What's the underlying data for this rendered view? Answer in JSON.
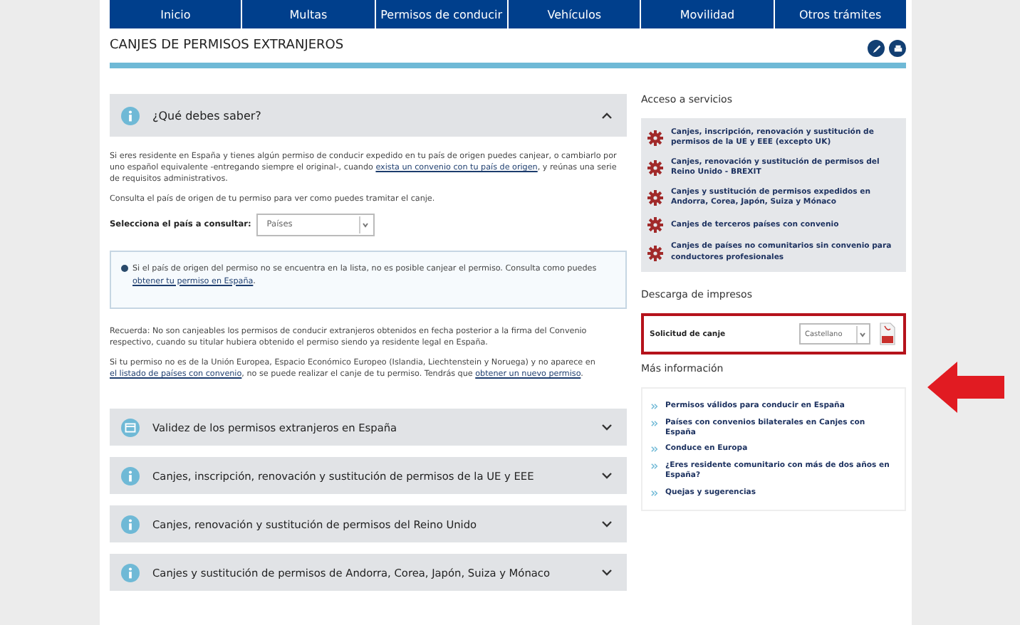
{
  "nav": [
    {
      "label": "Inicio"
    },
    {
      "label": "Multas"
    },
    {
      "label": "Permisos de conducir"
    },
    {
      "label": "Vehículos"
    },
    {
      "label": "Movilidad"
    },
    {
      "label": "Otros trámites"
    }
  ],
  "page_title": "CANJES DE PERMISOS EXTRANJEROS",
  "sections": [
    {
      "kind": "info",
      "title": "¿Qué debes saber?",
      "expanded": true
    },
    {
      "kind": "document",
      "title": "Validez de los permisos extranjeros en España",
      "expanded": false
    },
    {
      "kind": "info",
      "title": "Canjes, inscripción, renovación y sustitución de permisos de la UE y EEE",
      "expanded": false
    },
    {
      "kind": "info",
      "title": "Canjes, renovación y sustitución de permisos del Reino Unido",
      "expanded": false
    },
    {
      "kind": "info",
      "title": "Canjes y sustitución de permisos de Andorra, Corea, Japón, Suiza y Mónaco",
      "expanded": false
    }
  ],
  "content": {
    "paragraph_1": [
      {
        "kind": "text",
        "text": "Si eres residente en España y tienes algún permiso de conducir expedido en tu país de origen puedes canjear, o cambiarlo por uno español equivalente -entregando siempre el original-, cuando "
      },
      {
        "kind": "link",
        "text": "exista un convenio con tu país de origen"
      },
      {
        "kind": "text",
        "text": ", y reúnas una serie de requisitos administrativos."
      }
    ],
    "paragraph_2": [
      {
        "kind": "text",
        "text": "Consulta el país de origen de tu permiso para ver como puedes tramitar el canje."
      }
    ],
    "country_select": {
      "label": "Selecciona el país a consultar:",
      "value": "Países"
    },
    "notice": [
      {
        "kind": "text",
        "text": "Si el país de origen del permiso no se encuentra en la lista, no es posible canjear el permiso. Consulta como puedes "
      },
      {
        "kind": "link",
        "text": "obtener tu permiso en España"
      },
      {
        "kind": "text",
        "text": "."
      }
    ],
    "paragraph_3": [
      {
        "kind": "text",
        "text": "Recuerda: No son canjeables los permisos de conducir extranjeros obtenidos en fecha posterior a la firma del Convenio respectivo, cuando su titular hubiera obtenido el permiso siendo ya residente legal en España."
      }
    ],
    "paragraph_4": [
      {
        "kind": "text",
        "text": "Si tu permiso no es de la Unión Europea, Espacio Económico Europeo (Islandia, Liechtenstein y Noruega) y no aparece en "
      },
      {
        "kind": "link",
        "text": "el listado de países con convenio"
      },
      {
        "kind": "text",
        "text": ", no se puede realizar el canje de tu permiso. Tendrás que "
      },
      {
        "kind": "link",
        "text": "obtener un nuevo permiso"
      },
      {
        "kind": "text",
        "text": "."
      }
    ]
  },
  "services": {
    "title": "Acceso a servicios",
    "items": [
      {
        "label": "Canjes, inscripción, renovación y sustitución de permisos de la UE y EEE (excepto UK)"
      },
      {
        "label": "Canjes, renovación y sustitución de permisos del Reino Unido - BREXIT"
      },
      {
        "label": "Canjes y sustitución de permisos expedidos en Andorra, Corea, Japón, Suiza y Mónaco"
      },
      {
        "label": "Canjes de terceros países con convenio"
      },
      {
        "label": "Canjes de países no comunitarios sin convenio para conductores profesionales"
      }
    ]
  },
  "downloads": {
    "title": "Descarga de impresos",
    "highlighted": true,
    "form": {
      "label": "Solicitud de canje",
      "language": "Castellano"
    }
  },
  "more_info": {
    "title": "Más información",
    "links": [
      {
        "label": "Permisos válidos para conducir en España"
      },
      {
        "label": "Países con convenios bilaterales en Canjes con España"
      },
      {
        "label": "Conduce en Europa"
      },
      {
        "label": "¿Eres residente comunitario con más de dos años en España?"
      },
      {
        "label": "Quejas y sugerencias"
      }
    ]
  }
}
